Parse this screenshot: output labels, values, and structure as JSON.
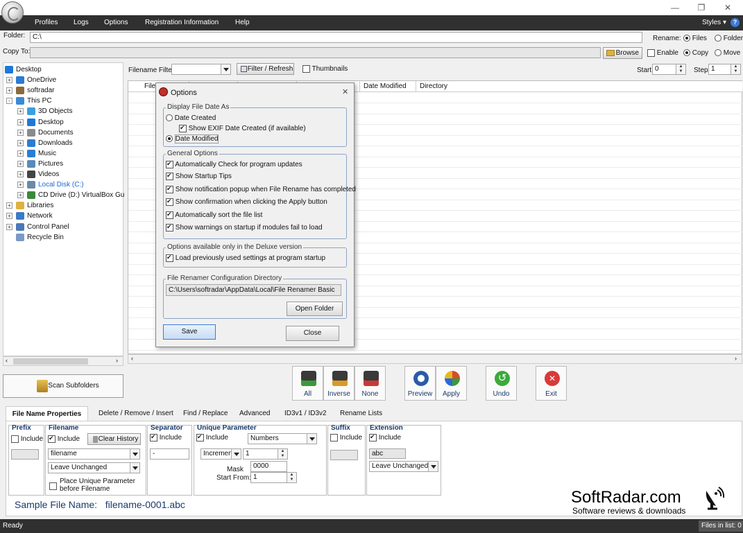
{
  "window": {
    "minimize": "—",
    "restore": "❐",
    "close": "✕"
  },
  "menu": {
    "items": [
      "Profiles",
      "Logs",
      "Options",
      "Registration Information",
      "Help"
    ],
    "styles": "Styles",
    "help_icon": "?"
  },
  "folder": {
    "label": "Folder:",
    "value": "C:\\"
  },
  "copy_to": {
    "label": "Copy To:",
    "value": ""
  },
  "browse_label": "Browse",
  "rename": {
    "label": "Rename:",
    "files": "Files",
    "folders": "Folders"
  },
  "enable_label": "Enable",
  "copy_label": "Copy",
  "move_label": "Move",
  "filter": {
    "label": "Filename Filter:",
    "value": "",
    "refresh": "Filter / Refresh",
    "thumbnails": "Thumbnails"
  },
  "start": {
    "label": "Start",
    "value": "0"
  },
  "step": {
    "label": "Step",
    "value": "1"
  },
  "tree": [
    {
      "label": "Desktop",
      "level": 0,
      "exp": "",
      "icon": "desktop-icon",
      "color": "#1e78d8"
    },
    {
      "label": "OneDrive",
      "level": 1,
      "exp": "+",
      "icon": "cloud-icon",
      "color": "#2b7cd3"
    },
    {
      "label": "softradar",
      "level": 1,
      "exp": "+",
      "icon": "user-icon",
      "color": "#8a6a3a"
    },
    {
      "label": "This PC",
      "level": 1,
      "exp": "-",
      "icon": "computer-icon",
      "color": "#3a8ad8"
    },
    {
      "label": "3D Objects",
      "level": 2,
      "exp": "+",
      "icon": "cube-icon",
      "color": "#3aa0e0"
    },
    {
      "label": "Desktop",
      "level": 2,
      "exp": "+",
      "icon": "desktop-icon",
      "color": "#1e78d8"
    },
    {
      "label": "Documents",
      "level": 2,
      "exp": "+",
      "icon": "document-icon",
      "color": "#8a8a8a"
    },
    {
      "label": "Downloads",
      "level": 2,
      "exp": "+",
      "icon": "download-icon",
      "color": "#2b7cd3"
    },
    {
      "label": "Music",
      "level": 2,
      "exp": "+",
      "icon": "music-icon",
      "color": "#2b7cd3"
    },
    {
      "label": "Pictures",
      "level": 2,
      "exp": "+",
      "icon": "picture-icon",
      "color": "#5a8ab8"
    },
    {
      "label": "Videos",
      "level": 2,
      "exp": "+",
      "icon": "video-icon",
      "color": "#444"
    },
    {
      "label": "Local Disk (C:)",
      "level": 2,
      "exp": "+",
      "icon": "disk-icon",
      "color": "#6a8aa8"
    },
    {
      "label": "CD Drive (D:) VirtualBox Gu",
      "level": 2,
      "exp": "+",
      "icon": "cd-icon",
      "color": "#3a8a3a"
    },
    {
      "label": "Libraries",
      "level": 1,
      "exp": "+",
      "icon": "folder-icon",
      "color": "#e0b040"
    },
    {
      "label": "Network",
      "level": 1,
      "exp": "+",
      "icon": "network-icon",
      "color": "#3a7ac8"
    },
    {
      "label": "Control Panel",
      "level": 1,
      "exp": "+",
      "icon": "control-panel-icon",
      "color": "#4a7ab8"
    },
    {
      "label": "Recycle Bin",
      "level": 1,
      "exp": "",
      "icon": "recycle-bin-icon",
      "color": "#7a9ac8"
    }
  ],
  "columns": [
    "File",
    "",
    "",
    "",
    "Date Modified",
    "Directory"
  ],
  "dialog": {
    "title": "Options",
    "close": "✕",
    "date_group": "Display File Date As",
    "date_created": "Date Created",
    "show_exif": "Show EXIF Date Created (if available)",
    "date_modified": "Date Modified",
    "general_group": "General Options",
    "general_options": [
      "Automatically Check for program updates",
      "Show Startup Tips",
      "Show notification popup when File Rename has completed",
      "Show confirmation when clicking the Apply button",
      "Automatically sort the file list",
      "Show warnings on startup if modules fail to load"
    ],
    "deluxe_group": "Options available only in the Deluxe version",
    "deluxe_option": "Load previously used settings at program startup",
    "config_group": "File Renamer Configuration Directory",
    "config_path": "C:\\Users\\softradar\\AppData\\Local\\File Renamer Basic",
    "open_folder": "Open Folder",
    "save": "Save",
    "close_btn": "Close"
  },
  "scan_subfolders": "Scan Subfolders",
  "actions": [
    {
      "label": "All",
      "icon": "select-all-icon",
      "color": "#3a9a3a"
    },
    {
      "label": "Inverse",
      "icon": "inverse-selection-icon",
      "color": "#d89a2a"
    },
    {
      "label": "None",
      "icon": "select-none-icon",
      "color": "#c83a3a"
    },
    {
      "label": "Preview",
      "icon": "preview-icon",
      "color": "#2a5aa8"
    },
    {
      "label": "Apply",
      "icon": "apply-icon",
      "color": "#d84a2a"
    },
    {
      "label": "Undo",
      "icon": "undo-icon",
      "color": "#3aaa3a"
    },
    {
      "label": "Exit",
      "icon": "exit-icon",
      "color": "#d83a3a"
    }
  ],
  "tabs": [
    "File Name Properties",
    "Delete / Remove / Insert",
    "Find / Replace",
    "Advanced",
    "ID3v1 / ID3v2",
    "Rename Lists"
  ],
  "props": {
    "prefix": {
      "title": "Prefix",
      "include": "Include",
      "value": ""
    },
    "filename": {
      "title": "Filename",
      "include": "Include",
      "clear_history": "Clear History",
      "value": "filename",
      "case": "Leave Unchanged",
      "place_unique": "Place Unique Parameter before Filename"
    },
    "separator": {
      "title": "Separator",
      "include": "Include",
      "value": "-"
    },
    "unique": {
      "title": "Unique Parameter",
      "include": "Include",
      "type": "Numbers",
      "mode": "Increment",
      "increment": "1",
      "mask_label": "Mask",
      "mask": "0000",
      "start_label": "Start From:",
      "start": "1"
    },
    "suffix": {
      "title": "Suffix",
      "include": "Include",
      "value": ""
    },
    "extension": {
      "title": "Extension",
      "include": "Include",
      "value": "abc",
      "case": "Leave Unchanged"
    }
  },
  "sample": {
    "label": "Sample File Name:",
    "value": "filename-0001.abc"
  },
  "watermark": {
    "brand": "SoftRadar.com",
    "tagline": "Software reviews & downloads"
  },
  "status": {
    "text": "Ready",
    "files": "Files in list: 0"
  }
}
